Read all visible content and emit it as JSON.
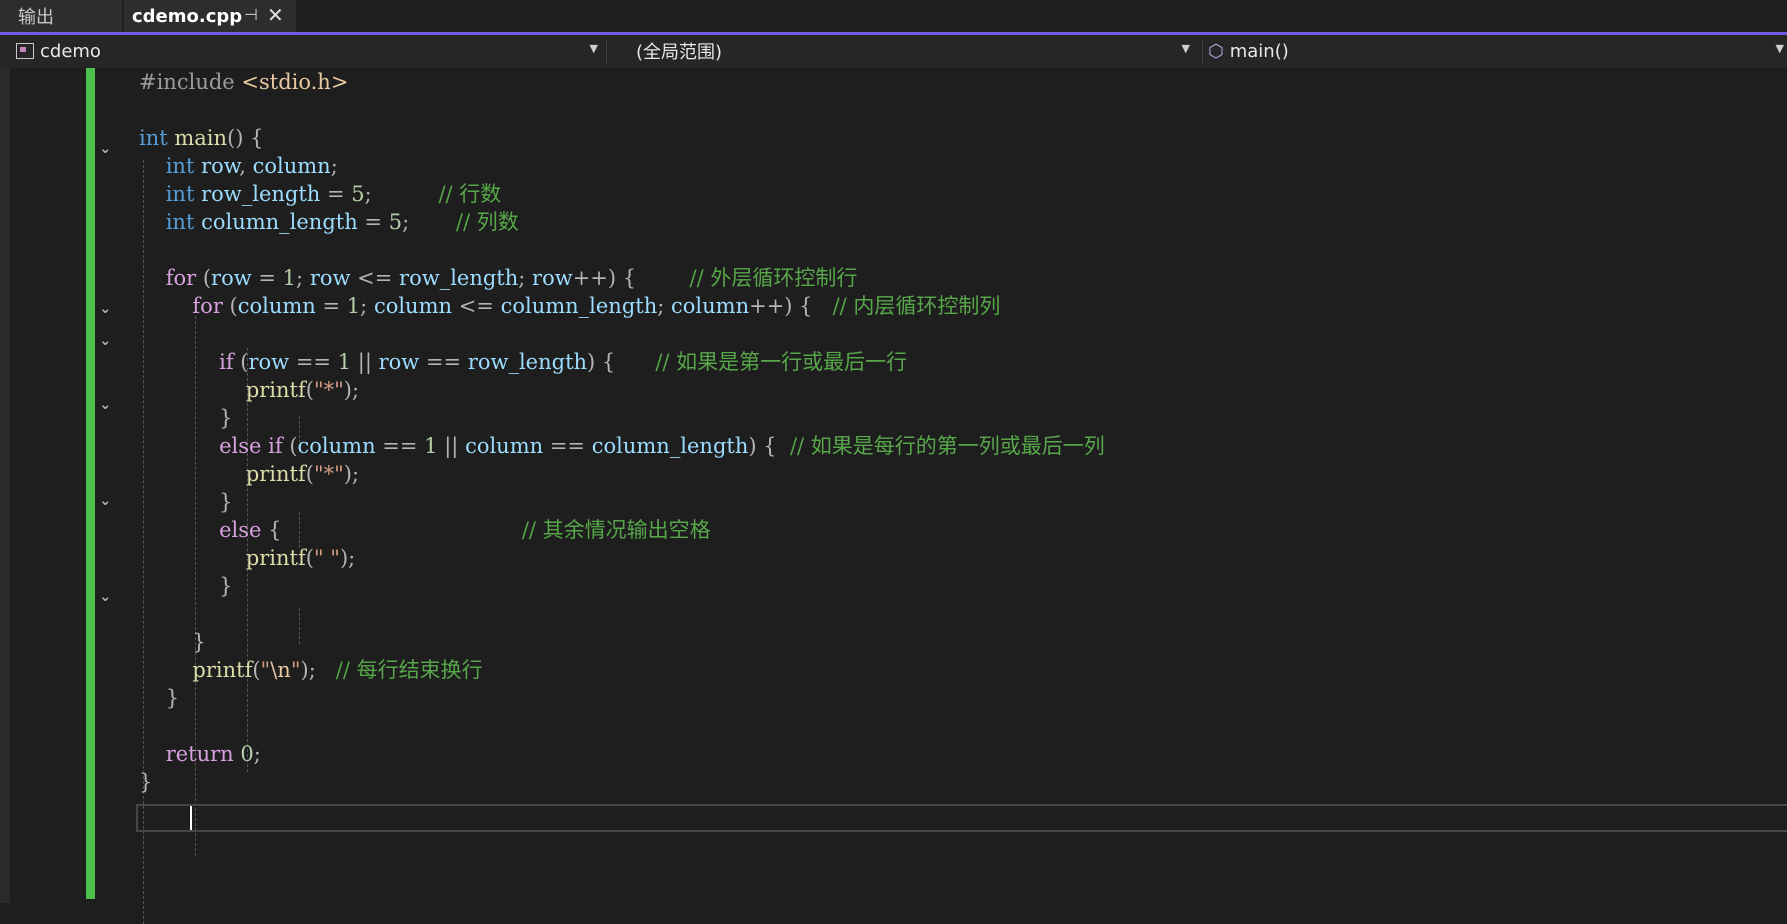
{
  "tabs": {
    "output_label": "输出",
    "file_label": "cdemo.cpp",
    "pin_glyph": "⊣",
    "close_glyph": "✕"
  },
  "navbar": {
    "project": "cdemo",
    "scope": "(全局范围)",
    "member": "main()"
  },
  "code": {
    "l1_directive": "#include ",
    "l1_header": "<stdio.h>",
    "t_int": "int",
    "t_for": "for",
    "t_if": "if",
    "t_else": "else",
    "t_return": "return",
    "fn_main": "main",
    "fn_printf": "printf",
    "v_row": "row",
    "v_column": "column",
    "v_row_length": "row_length",
    "v_column_length": "column_length",
    "n_1": "1",
    "n_5": "5",
    "n_0": "0",
    "s_star": "\"*\"",
    "s_space": "\" \"",
    "s_nl_open": "\"",
    "s_nl_esc": "\\n",
    "s_nl_close": "\"",
    "c_rows": "// 行数",
    "c_cols": "// 列数",
    "c_outer": "// 外层循环控制行",
    "c_inner": "// 内层循环控制列",
    "c_first_last": "// 如果是第一行或最后一行",
    "c_each_row": "// 如果是每行的第一列或最后一列",
    "c_else": "// 其余情况输出空格",
    "c_row_end": "// 每行结束换行"
  }
}
